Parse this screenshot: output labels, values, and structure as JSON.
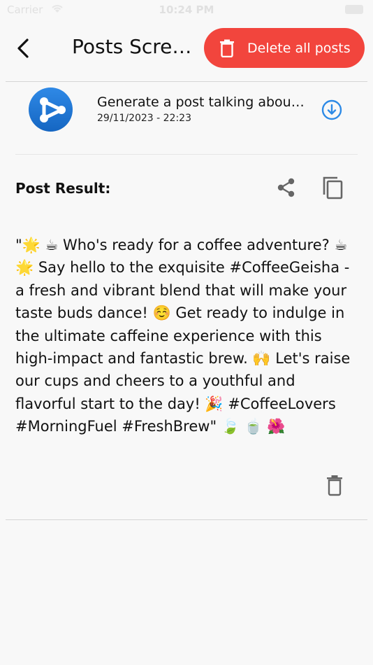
{
  "status_bar": {
    "carrier": "Carrier",
    "time": "10:24 PM"
  },
  "app_bar": {
    "title": "Posts Screen",
    "delete_all_label": "Delete all posts"
  },
  "post": {
    "title": "Generate a post talking about CoffeeGeisha",
    "date": "29/11/2023 - 22:23",
    "result_label": "Post Result:",
    "body": "\"🌟 ☕ Who's ready for a coffee adventure? ☕ 🌟 Say hello to the exquisite #CoffeeGeisha - a fresh and vibrant blend that will make your taste buds dance! ☺️ Get ready to indulge in the ultimate caffeine experience with this high-impact and fantastic brew. 🙌 Let's raise our cups and cheers to a youthful and flavorful start to the day! 🎉 #CoffeeLovers #MorningFuel #FreshBrew\" 🍃 🍵 🌺"
  },
  "colors": {
    "accent_red": "#f2453d",
    "accent_blue": "#2d8ae6",
    "icon_gray": "#666666"
  },
  "icons": [
    "back-chevron-icon",
    "trash-icon",
    "share-icon",
    "copy-icon",
    "download-circle-icon",
    "app-logo-icon"
  ]
}
